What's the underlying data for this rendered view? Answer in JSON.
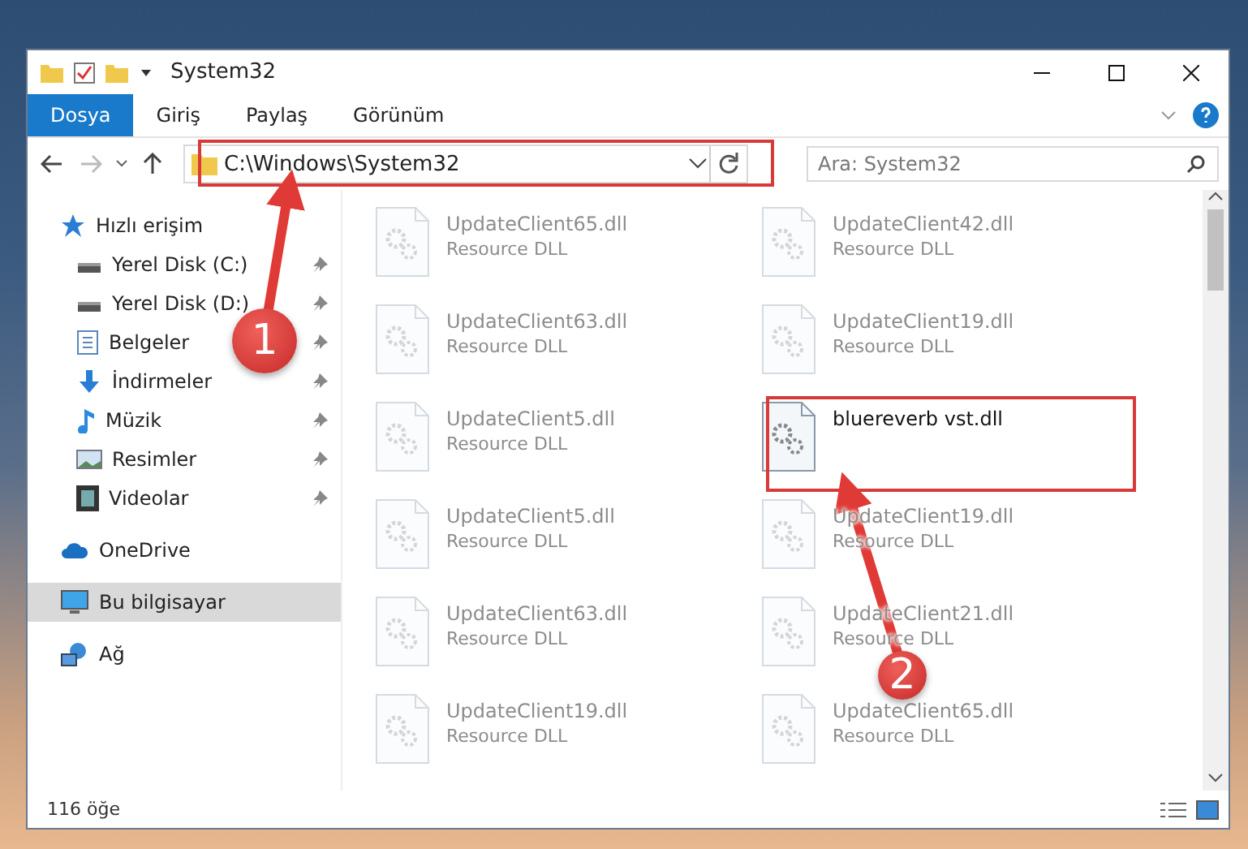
{
  "window": {
    "title": "System32"
  },
  "ribbon_tabs": [
    {
      "label": "Dosya",
      "selected": true
    },
    {
      "label": "Giriş",
      "selected": false
    },
    {
      "label": "Paylaş",
      "selected": false
    },
    {
      "label": "Görünüm",
      "selected": false
    }
  ],
  "address": {
    "path": "C:\\Windows\\System32"
  },
  "search": {
    "placeholder": "Ara: System32"
  },
  "sidebar": {
    "items": [
      {
        "label": "Hızlı erişim",
        "kind": "star",
        "selected": false,
        "children": [
          {
            "label": "Yerel Disk (C:)",
            "kind": "drive",
            "pinned": true
          },
          {
            "label": "Yerel Disk (D:)",
            "kind": "drive",
            "pinned": true
          },
          {
            "label": "Belgeler",
            "kind": "document",
            "pinned": true
          },
          {
            "label": "İndirmeler",
            "kind": "download",
            "pinned": true
          },
          {
            "label": "Müzik",
            "kind": "music",
            "pinned": true
          },
          {
            "label": "Resimler",
            "kind": "picture",
            "pinned": true
          },
          {
            "label": "Videolar",
            "kind": "video",
            "pinned": true
          }
        ]
      },
      {
        "label": "OneDrive",
        "kind": "cloud",
        "selected": false
      },
      {
        "label": "Bu bilgisayar",
        "kind": "computer",
        "selected": true
      },
      {
        "label": "Ağ",
        "kind": "network",
        "selected": false
      }
    ]
  },
  "files": [
    {
      "name": "UpdateClient65.dll",
      "type": "Resource DLL",
      "dimmed": true
    },
    {
      "name": "UpdateClient42.dll",
      "type": "Resource DLL",
      "dimmed": true
    },
    {
      "name": "UpdateClient63.dll",
      "type": "Resource DLL",
      "dimmed": true
    },
    {
      "name": "UpdateClient19.dll",
      "type": "Resource DLL",
      "dimmed": true
    },
    {
      "name": "UpdateClient5.dll",
      "type": "Resource DLL",
      "dimmed": true
    },
    {
      "name": "bluereverb vst.dll",
      "dimmed": false
    },
    {
      "name": "UpdateClient5.dll",
      "type": "Resource DLL",
      "dimmed": true
    },
    {
      "name": "UpdateClient19.dll",
      "type": "Resource DLL",
      "dimmed": true
    },
    {
      "name": "UpdateClient63.dll",
      "type": "Resource DLL",
      "dimmed": true
    },
    {
      "name": "UpdateClient21.dll",
      "type": "Resource DLL",
      "dimmed": true
    },
    {
      "name": "UpdateClient19.dll",
      "type": "Resource DLL",
      "dimmed": true
    },
    {
      "name": "UpdateClient65.dll",
      "type": "Resource DLL",
      "dimmed": true
    }
  ],
  "status_bar": {
    "count": "116 öğe"
  },
  "annotations": [
    {
      "label": "1"
    },
    {
      "label": "2"
    }
  ]
}
